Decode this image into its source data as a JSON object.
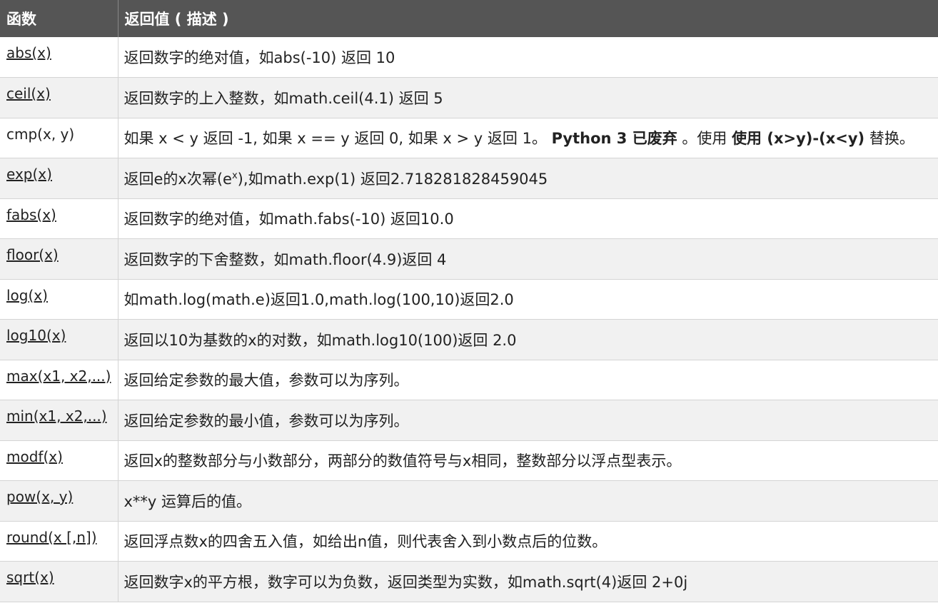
{
  "header": {
    "col_function": "函数",
    "col_description": "返回值 ( 描述 )"
  },
  "rows": [
    {
      "fn": "abs(x)",
      "desc": "返回数字的绝对值，如abs(-10) 返回 10"
    },
    {
      "fn": "ceil(x)",
      "desc": "返回数字的上入整数，如math.ceil(4.1) 返回 5"
    },
    {
      "fn": "cmp(x, y)",
      "desc_a": "如果 x < y 返回 -1, 如果 x == y 返回 0, 如果 x > y 返回 1。 ",
      "desc_b": "Python 3 已废弃",
      "desc_c": " 。使用 ",
      "desc_d": "使用 (x>y)-(x<y)",
      "desc_e": " 替换。"
    },
    {
      "fn": "exp(x)",
      "desc_pre": "返回e的x次幂(e",
      "desc_sup": "x",
      "desc_post": "),如math.exp(1) 返回2.718281828459045"
    },
    {
      "fn": "fabs(x)",
      "desc": "返回数字的绝对值，如math.fabs(-10) 返回10.0"
    },
    {
      "fn": "floor(x)",
      "desc": "返回数字的下舍整数，如math.floor(4.9)返回 4"
    },
    {
      "fn": "log(x)",
      "desc": "如math.log(math.e)返回1.0,math.log(100,10)返回2.0"
    },
    {
      "fn": "log10(x)",
      "desc": "返回以10为基数的x的对数，如math.log10(100)返回 2.0"
    },
    {
      "fn": "max(x1, x2,...)",
      "desc": "返回给定参数的最大值，参数可以为序列。"
    },
    {
      "fn": "min(x1, x2,...)",
      "desc": "返回给定参数的最小值，参数可以为序列。"
    },
    {
      "fn": "modf(x)",
      "desc": "返回x的整数部分与小数部分，两部分的数值符号与x相同，整数部分以浮点型表示。"
    },
    {
      "fn": "pow(x, y)",
      "desc": "x**y 运算后的值。"
    },
    {
      "fn": "round(x [,n])",
      "desc": "返回浮点数x的四舍五入值，如给出n值，则代表舍入到小数点后的位数。"
    },
    {
      "fn": "sqrt(x)",
      "desc": "返回数字x的平方根，数字可以为负数，返回类型为实数，如math.sqrt(4)返回 2+0j"
    }
  ]
}
